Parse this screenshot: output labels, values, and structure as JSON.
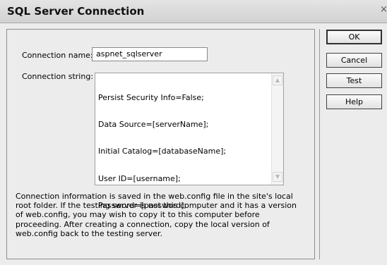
{
  "window": {
    "title": "SQL Server Connection",
    "close_glyph": "×"
  },
  "form": {
    "connection_name_label": "Connection name:",
    "connection_name_value": "aspnet_sqlserver",
    "connection_string_label": "Connection string:",
    "connection_string_lines": [
      "Persist Security Info=False;",
      "Data Source=[serverName];",
      "Initial Catalog=[databaseName];",
      "User ID=[username];",
      "Password=[password];"
    ],
    "scroll_up_glyph": "▲",
    "scroll_down_glyph": "▼"
  },
  "info": {
    "lines": [
      "Connection information is saved in the web.config file in the site's local",
      "root folder. If the testing server is not this computer and it has a version",
      "of web.config, you may wish to copy it to this computer before",
      "proceeding. After creating a connection, copy the local version of",
      "web.config back to the testing server."
    ]
  },
  "buttons": {
    "ok": "OK",
    "cancel": "Cancel",
    "test": "Test",
    "help": "Help"
  },
  "icons": {
    "close": "close-icon",
    "scroll_up": "scroll-up-arrow-icon",
    "scroll_down": "scroll-down-arrow-icon"
  }
}
